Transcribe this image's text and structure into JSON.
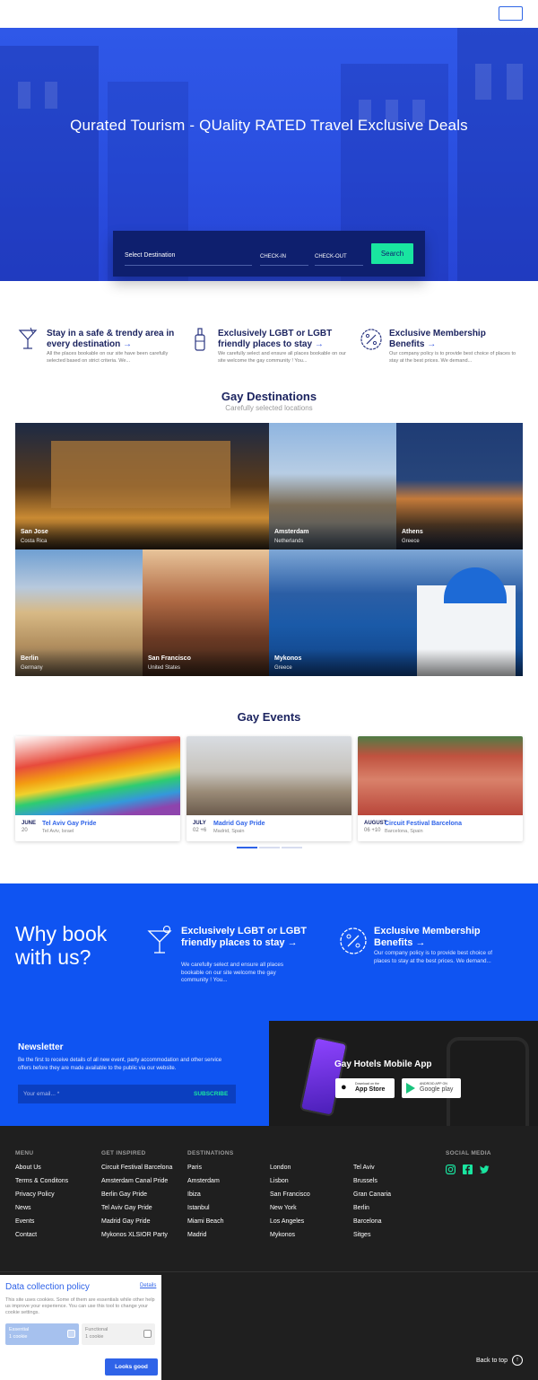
{
  "hero": {
    "title": "Qurated Tourism - QUality RATED Travel Exclusive Deals",
    "search": {
      "destination_placeholder": "Select Destination",
      "checkin_placeholder": "CHECK-IN",
      "checkout_placeholder": "CHECK-OUT",
      "button_label": "Search"
    }
  },
  "features": [
    {
      "title": "Stay in a safe & trendy area in every destination",
      "arrow": "→",
      "desc": "All the places bookable on our site have been carefully selected based on strict criteria. We...",
      "icon": "cocktail-icon"
    },
    {
      "title": "Exclusively LGBT or LGBT friendly places to stay",
      "arrow": "→",
      "desc": "We carefully select and ensure all places bookable on our site welcome the gay community ! You...",
      "icon": "bottle-icon"
    },
    {
      "title": "Exclusive Membership Benefits",
      "arrow": "→",
      "desc": "Our company policy is to provide best choice of places to stay at the best prices. We demand...",
      "icon": "discount-badge-icon"
    }
  ],
  "destinations": {
    "title": "Gay Destinations",
    "subtitle": "Carefully selected locations",
    "items": [
      {
        "name": "San Jose",
        "country": "Costa Rica"
      },
      {
        "name": "Amsterdam",
        "country": "Netherlands"
      },
      {
        "name": "Athens",
        "country": "Greece"
      },
      {
        "name": "Berlin",
        "country": "Germany"
      },
      {
        "name": "San Francisco",
        "country": "United States"
      },
      {
        "name": "Mykonos",
        "country": "Greece"
      }
    ]
  },
  "events": {
    "title": "Gay Events",
    "items": [
      {
        "month": "JUNE",
        "day": "20",
        "name": "Tel Aviv Gay Pride",
        "place": "Tel Aviv, Israel"
      },
      {
        "month": "JULY",
        "day": "02 +6",
        "name": "Madrid Gay Pride",
        "place": "Madrid, Spain"
      },
      {
        "month": "AUGUST",
        "day": "06 +10",
        "name": "Circuit Festival Barcelona",
        "place": "Barcelona, Spain"
      }
    ]
  },
  "why": {
    "title": "Why book with us?",
    "items": [
      {
        "title": "Exclusively LGBT or LGBT friendly places to stay",
        "arrow": "→",
        "desc": "We carefully select and ensure all places bookable on our site welcome the gay community ! You...",
        "icon": "cocktail-icon"
      },
      {
        "title": "Exclusive Membership Benefits",
        "arrow": "→",
        "desc": "Our company policy is to provide best choice of places to stay at the best prices. We demand...",
        "icon": "discount-badge-icon"
      }
    ]
  },
  "newsletter": {
    "title": "Newsletter",
    "desc": "Be the first to receive details of all new event, party accommodation and other service offers before they are made available to the public via our website.",
    "placeholder": "Your email... *",
    "button": "SUBSCRIBE"
  },
  "app": {
    "title": "Gay Hotels Mobile App",
    "app_store": {
      "small": "Download on the",
      "big": "App Store"
    },
    "google_play": {
      "small": "ANDROID APP ON",
      "big": "Google play"
    }
  },
  "footer": {
    "menu": {
      "heading": "MENU",
      "links": [
        "About Us",
        "Terms & Conditons",
        "Privacy Policy",
        "News",
        "Events",
        "Contact"
      ]
    },
    "inspired": {
      "heading": "GET INSPIRED",
      "links": [
        "Circuit Festival Barcelona",
        "Amsterdam Canal Pride",
        "Berlin Gay Pride",
        "Tel Aviv Gay Pride",
        "Madrid Gay Pride",
        "Mykonos XLSIOR Party"
      ]
    },
    "destinations": {
      "heading": "DESTINATIONS",
      "col1": [
        "Paris",
        "Amsterdam",
        "Ibiza",
        "Istanbul",
        "Miami Beach",
        "Madrid"
      ],
      "col2": [
        "London",
        "Lisbon",
        "San Francisco",
        "New York",
        "Los Angeles",
        "Mykonos"
      ],
      "col3": [
        "Tel Aviv",
        "Brussels",
        "Gran Canaria",
        "Berlin",
        "Barcelona",
        "Sitges"
      ]
    },
    "social": {
      "heading": "SOCIAL MEDIA",
      "icons": [
        "instagram-icon",
        "facebook-icon",
        "twitter-icon"
      ]
    },
    "back_to_top": "Back to top"
  },
  "cookie": {
    "title": "Data collection policy",
    "details": "Details",
    "text": "This site uses cookies. Some of them are essentials while other help us improve your experience. You can use this tool to change your cookie settings.",
    "essential": {
      "label": "Essential",
      "count": "1 cookie"
    },
    "functional": {
      "label": "Functional",
      "count": "1 cookie"
    },
    "button": "Looks good"
  },
  "colors": {
    "brand_blue": "#0f54f2",
    "accent_green": "#19e5a0",
    "navy": "#0e1f6e"
  }
}
